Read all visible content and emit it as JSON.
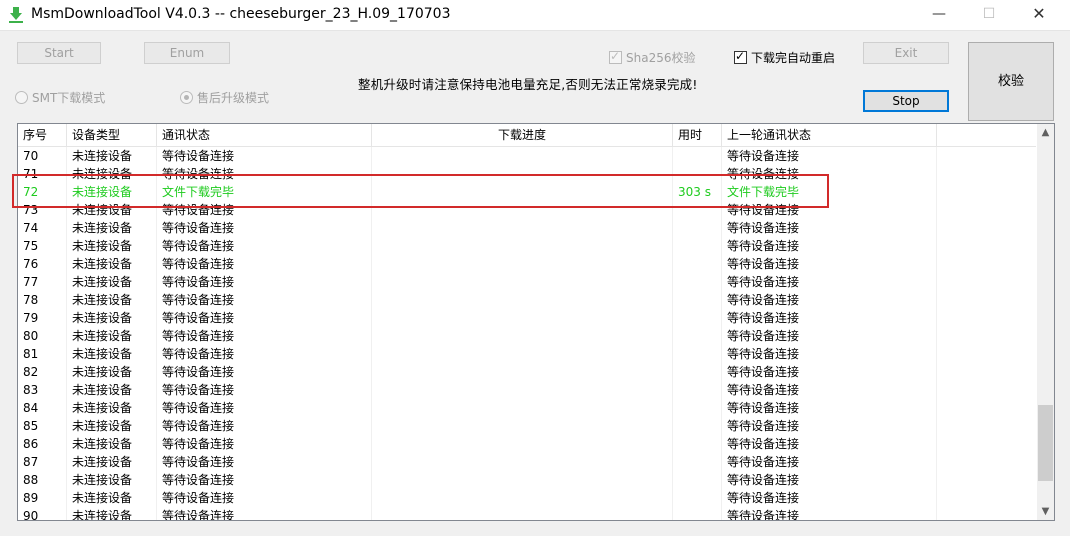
{
  "window": {
    "title": "MsmDownloadTool V4.0.3 -- cheeseburger_23_H.09_170703",
    "min_glyph": "—",
    "max_glyph": "☐",
    "close_glyph": "✕"
  },
  "toolbar": {
    "start_label": "Start",
    "enum_label": "Enum",
    "sha_label": "Sha256校验",
    "auto_reboot_label": "下载完自动重启",
    "exit_label": "Exit",
    "stop_label": "Stop",
    "verify_label": "校验",
    "smt_mode_label": "SMT下载模式",
    "upgrade_mode_label": "售后升级模式",
    "warning_text": "整机升级时请注意保持电池电量充足,否则无法正常烧录完成!",
    "check_glyph": "✓"
  },
  "table": {
    "headers": [
      "序号",
      "设备类型",
      "通讯状态",
      "下载进度",
      "用时",
      "上一轮通讯状态"
    ],
    "rows": [
      {
        "no": "70",
        "type": "未连接设备",
        "status": "等待设备连接",
        "progress": "",
        "time": "",
        "prev": "等待设备连接"
      },
      {
        "no": "71",
        "type": "未连接设备",
        "status": "等待设备连接",
        "progress": "",
        "time": "",
        "prev": "等待设备连接"
      },
      {
        "no": "72",
        "type": "未连接设备",
        "status": "文件下载完毕",
        "progress": "",
        "time": "303 s",
        "prev": "文件下载完毕"
      },
      {
        "no": "73",
        "type": "未连接设备",
        "status": "等待设备连接",
        "progress": "",
        "time": "",
        "prev": "等待设备连接"
      },
      {
        "no": "74",
        "type": "未连接设备",
        "status": "等待设备连接",
        "progress": "",
        "time": "",
        "prev": "等待设备连接"
      },
      {
        "no": "75",
        "type": "未连接设备",
        "status": "等待设备连接",
        "progress": "",
        "time": "",
        "prev": "等待设备连接"
      },
      {
        "no": "76",
        "type": "未连接设备",
        "status": "等待设备连接",
        "progress": "",
        "time": "",
        "prev": "等待设备连接"
      },
      {
        "no": "77",
        "type": "未连接设备",
        "status": "等待设备连接",
        "progress": "",
        "time": "",
        "prev": "等待设备连接"
      },
      {
        "no": "78",
        "type": "未连接设备",
        "status": "等待设备连接",
        "progress": "",
        "time": "",
        "prev": "等待设备连接"
      },
      {
        "no": "79",
        "type": "未连接设备",
        "status": "等待设备连接",
        "progress": "",
        "time": "",
        "prev": "等待设备连接"
      },
      {
        "no": "80",
        "type": "未连接设备",
        "status": "等待设备连接",
        "progress": "",
        "time": "",
        "prev": "等待设备连接"
      },
      {
        "no": "81",
        "type": "未连接设备",
        "status": "等待设备连接",
        "progress": "",
        "time": "",
        "prev": "等待设备连接"
      },
      {
        "no": "82",
        "type": "未连接设备",
        "status": "等待设备连接",
        "progress": "",
        "time": "",
        "prev": "等待设备连接"
      },
      {
        "no": "83",
        "type": "未连接设备",
        "status": "等待设备连接",
        "progress": "",
        "time": "",
        "prev": "等待设备连接"
      },
      {
        "no": "84",
        "type": "未连接设备",
        "status": "等待设备连接",
        "progress": "",
        "time": "",
        "prev": "等待设备连接"
      },
      {
        "no": "85",
        "type": "未连接设备",
        "status": "等待设备连接",
        "progress": "",
        "time": "",
        "prev": "等待设备连接"
      },
      {
        "no": "86",
        "type": "未连接设备",
        "status": "等待设备连接",
        "progress": "",
        "time": "",
        "prev": "等待设备连接"
      },
      {
        "no": "87",
        "type": "未连接设备",
        "status": "等待设备连接",
        "progress": "",
        "time": "",
        "prev": "等待设备连接"
      },
      {
        "no": "88",
        "type": "未连接设备",
        "status": "等待设备连接",
        "progress": "",
        "time": "",
        "prev": "等待设备连接"
      },
      {
        "no": "89",
        "type": "未连接设备",
        "status": "等待设备连接",
        "progress": "",
        "time": "",
        "prev": "等待设备连接"
      },
      {
        "no": "90",
        "type": "未连接设备",
        "status": "等待设备连接",
        "progress": "",
        "time": "",
        "prev": "等待设备连接"
      }
    ],
    "highlighted_row": "72"
  },
  "colors": {
    "done_text": "#1ecb1e",
    "highlight_box": "#d22a2a",
    "focus_border": "#0078d7"
  },
  "scrollbar": {
    "up_glyph": "▲",
    "down_glyph": "▼"
  }
}
